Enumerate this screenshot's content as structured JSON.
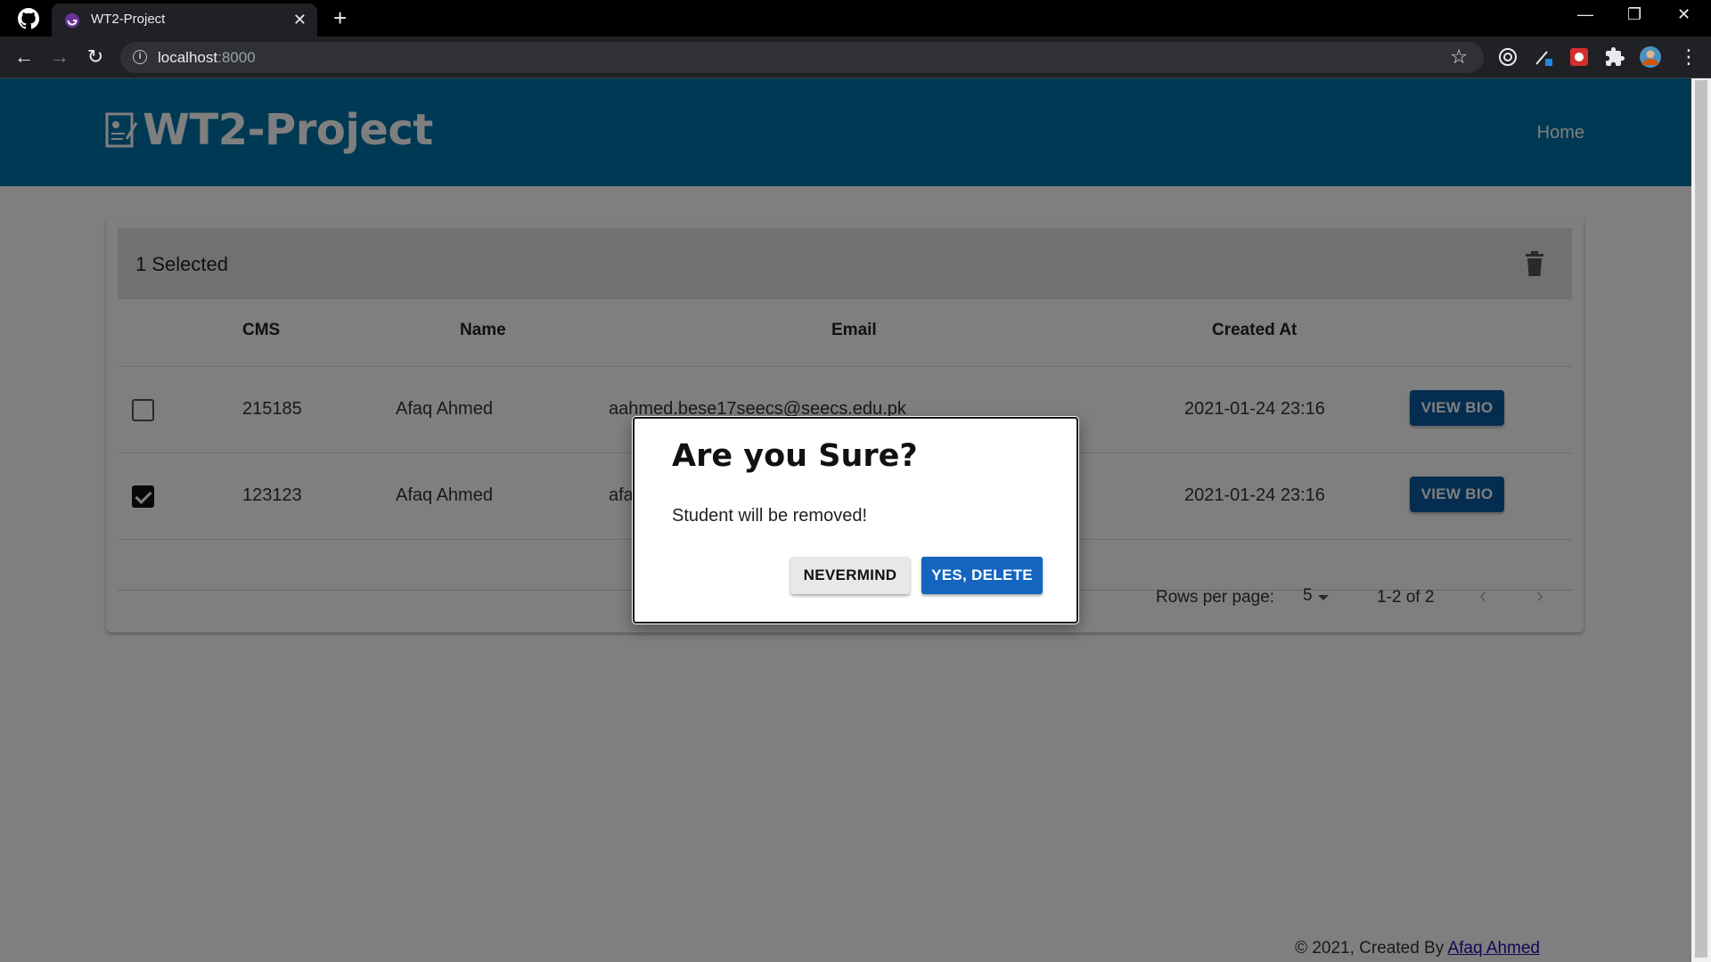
{
  "browser": {
    "tab_title": "WT2-Project",
    "url_host": "localhost",
    "url_port": ":8000",
    "new_tab_symbol": "+",
    "close_symbol": "✕"
  },
  "app": {
    "brand": "WT2-Project",
    "nav_home": "Home",
    "primary_color": "#0072a8"
  },
  "table": {
    "selected_text": "1 Selected",
    "headers": {
      "cms": "CMS",
      "name": "Name",
      "email": "Email",
      "created": "Created At"
    },
    "rows": [
      {
        "checked": false,
        "cms": "215185",
        "name": "Afaq Ahmed",
        "email": "aahmed.bese17seecs@seecs.edu.pk",
        "created": "2021-01-24 23:16",
        "action": "VIEW BIO"
      },
      {
        "checked": true,
        "cms": "123123",
        "name": "Afaq Ahmed",
        "email": "afa",
        "created": "2021-01-24 23:16",
        "action": "VIEW BIO"
      }
    ]
  },
  "pagination": {
    "rows_per_page_label": "Rows per page:",
    "rows_per_page_value": "5",
    "range": "1-2 of 2"
  },
  "footer": {
    "prefix": "© 2021, Created By ",
    "author": "Afaq Ahmed"
  },
  "dialog": {
    "title": "Are you Sure?",
    "body": "Student will be removed!",
    "cancel_label": "NEVERMIND",
    "confirm_label": "YES, DELETE"
  }
}
